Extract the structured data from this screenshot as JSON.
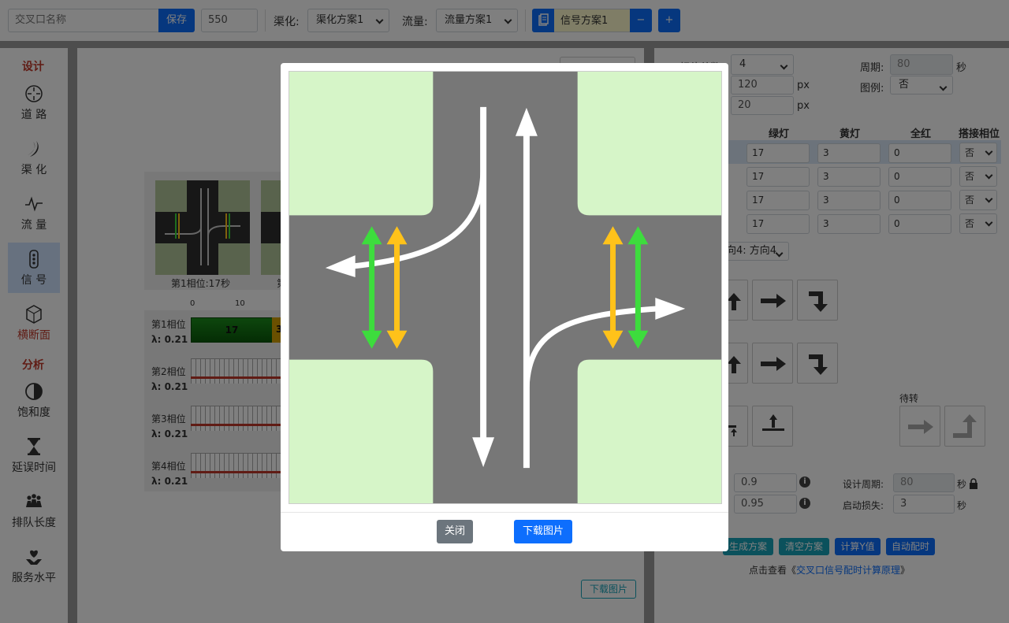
{
  "toolbar": {
    "intersection_placeholder": "交叉口名称",
    "save_label": "保存",
    "size_value": "550",
    "channel_label": "渠化:",
    "channel_value": "渠化方案1",
    "flow_label": "流量:",
    "flow_value": "流量方案1",
    "signal_value": "信号方案1",
    "minus_label": "−",
    "plus_label": "+"
  },
  "sidebar": {
    "design_heading": "设计",
    "analysis_heading": "分析",
    "items": [
      {
        "label": "道 路",
        "icon": "crosshair-icon"
      },
      {
        "label": "渠 化",
        "icon": "moon-icon"
      },
      {
        "label": "流 量",
        "icon": "pulse-icon"
      },
      {
        "label": "信 号",
        "icon": "traffic-light-icon"
      },
      {
        "label": "横断面",
        "icon": "hexagon-icon"
      },
      {
        "label": "饱和度",
        "icon": "half-circle-icon"
      },
      {
        "label": "延误时间",
        "icon": "hourglass-icon"
      },
      {
        "label": "排队长度",
        "icon": "people-icon"
      },
      {
        "label": "服务水平",
        "icon": "heart-hand-icon"
      }
    ]
  },
  "center": {
    "phase_card_caption": "第1相位:17秒",
    "phase_card_caption2": "第",
    "tick_0": "0",
    "tick_10": "10",
    "phases": [
      {
        "name": "第1相位",
        "lambda": "λ: 0.21",
        "green": "17",
        "yellow": "3"
      },
      {
        "name": "第2相位",
        "lambda": "λ: 0.21"
      },
      {
        "name": "第3相位",
        "lambda": "λ: 0.21"
      },
      {
        "name": "第4相位",
        "lambda": "λ: 0.21"
      }
    ],
    "download_label": "下载图片"
  },
  "right": {
    "phase_count_label": "相位总数",
    "phase_count_value": "4",
    "cycle_label": "周期:",
    "cycle_value": "80",
    "cycle_unit": "秒",
    "width_value": "120",
    "height_value": "20",
    "px_unit": "px",
    "legend_label": "图例:",
    "legend_value": "否",
    "headers": [
      "绿灯",
      "黄灯",
      "全红",
      "搭接相位"
    ],
    "rows": [
      {
        "green": "17",
        "yellow": "3",
        "red": "0",
        "overlap": "否"
      },
      {
        "green": "17",
        "yellow": "3",
        "red": "0",
        "overlap": "否"
      },
      {
        "green": "17",
        "yellow": "3",
        "red": "0",
        "overlap": "否"
      },
      {
        "green": "17",
        "yellow": "3",
        "red": "0",
        "overlap": "否"
      }
    ],
    "direction_value": "向4: 方向4",
    "wait_turn_label": "待转",
    "sat_value": "0.9",
    "factor_value": "0.95",
    "design_cycle_label": "设计周期:",
    "design_cycle_value": "80",
    "start_loss_label": "启动损失:",
    "start_loss_value": "3",
    "sec_unit": "秒",
    "gen_label": "生成方案",
    "clear_label": "清空方案",
    "calc_y_label": "计算Y值",
    "auto_label": "自动配时",
    "link_prefix": "点击查看《",
    "link_text": "交叉口信号配时计算原理",
    "link_suffix": "》"
  },
  "modal": {
    "close_label": "关闭",
    "download_label": "下载图片"
  },
  "colors": {
    "primary": "#0d6efd",
    "green_arrow": "#3ddc3d",
    "yellow_arrow": "#ffc21a",
    "grass": "#d6f5c8",
    "road": "#777777",
    "teal": "#17a2b8"
  }
}
